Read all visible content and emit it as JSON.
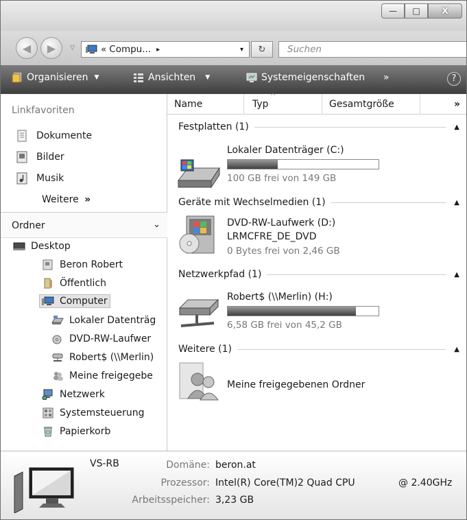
{
  "window": {
    "controls": {
      "minimize": "—",
      "maximize": "□",
      "close": "X"
    }
  },
  "address": {
    "back_icon": "arrow-left",
    "forward_icon": "arrow-right",
    "path_prefix": "«",
    "path_label": "Compu...",
    "crumb_arrow": "▸",
    "dropdown": "▾",
    "refresh": "↻",
    "search_placeholder": "Suchen"
  },
  "toolbar": {
    "organize": "Organisieren",
    "views": "Ansichten",
    "system_props": "Systemeigenschaften",
    "overflow": "»",
    "help": "?"
  },
  "sidebar": {
    "favorites_title": "Linkfavoriten",
    "favorites": [
      "Dokumente",
      "Bilder",
      "Musik"
    ],
    "more_label": "Weitere",
    "more_chevron": "»",
    "folders_title": "Ordner",
    "folders_chevron": "⌄",
    "tree": [
      {
        "label": "Desktop",
        "level": 0
      },
      {
        "label": "Beron Robert",
        "level": 1
      },
      {
        "label": "Öffentlich",
        "level": 1
      },
      {
        "label": "Computer",
        "level": 1,
        "selected": true
      },
      {
        "label": "Lokaler Datenträg",
        "level": 2
      },
      {
        "label": "DVD-RW-Laufwer",
        "level": 2
      },
      {
        "label": "Robert$ (\\\\Merlin)",
        "level": 2
      },
      {
        "label": "Meine freigegebe",
        "level": 2
      },
      {
        "label": "Netzwerk",
        "level": 1
      },
      {
        "label": "Systemsteuerung",
        "level": 1
      },
      {
        "label": "Papierkorb",
        "level": 1
      }
    ]
  },
  "columns": [
    "Name",
    "Typ",
    "Gesamtgröße",
    "»"
  ],
  "groups": {
    "hdd": {
      "title": "Festplatten (1)",
      "name": "Lokaler Datenträger (C:)",
      "free": "100 GB frei von 149 GB",
      "used_fraction": 0.33
    },
    "removable": {
      "title": "Geräte mit Wechselmedien (1)",
      "name": "DVD-RW-Laufwerk (D:)",
      "label": "LRMCFRE_DE_DVD",
      "free": "0 Bytes frei von 2,46 GB"
    },
    "network": {
      "title": "Netzwerkpfad (1)",
      "name": "Robert$ (\\\\Merlin) (H:)",
      "free": "6,58 GB frei von 45,2 GB",
      "used_fraction": 0.85
    },
    "other": {
      "title": "Weitere (1)",
      "name": "Meine freigegebenen Ordner"
    }
  },
  "details": {
    "computer_name": "VS-RB",
    "domain_label": "Domäne:",
    "domain_value": "beron.at",
    "cpu_label": "Prozessor:",
    "cpu_value": "Intel(R) Core(TM)2 Quad CPU",
    "cpu_speed": "@ 2.40GHz",
    "ram_label": "Arbeitsspeicher:",
    "ram_value": "3,23 GB"
  }
}
